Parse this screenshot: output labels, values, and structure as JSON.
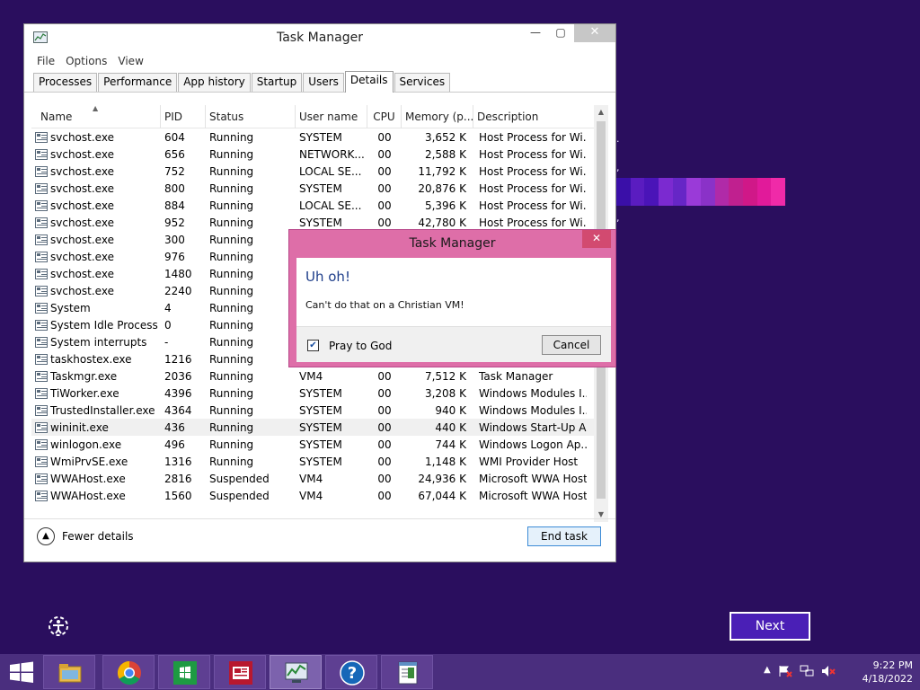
{
  "task_manager": {
    "title": "Task Manager",
    "menu": [
      "File",
      "Options",
      "View"
    ],
    "tabs": [
      "Processes",
      "Performance",
      "App history",
      "Startup",
      "Users",
      "Details",
      "Services"
    ],
    "active_tab": "Details",
    "columns": [
      "Name",
      "PID",
      "Status",
      "User name",
      "CPU",
      "Memory (p...",
      "Description"
    ],
    "rows": [
      {
        "name": "svchost.exe",
        "pid": "604",
        "status": "Running",
        "user": "SYSTEM",
        "cpu": "00",
        "mem": "3,652 K",
        "desc": "Host Process for Wi..."
      },
      {
        "name": "svchost.exe",
        "pid": "656",
        "status": "Running",
        "user": "NETWORK...",
        "cpu": "00",
        "mem": "2,588 K",
        "desc": "Host Process for Wi..."
      },
      {
        "name": "svchost.exe",
        "pid": "752",
        "status": "Running",
        "user": "LOCAL SE...",
        "cpu": "00",
        "mem": "11,792 K",
        "desc": "Host Process for Wi..."
      },
      {
        "name": "svchost.exe",
        "pid": "800",
        "status": "Running",
        "user": "SYSTEM",
        "cpu": "00",
        "mem": "20,876 K",
        "desc": "Host Process for Wi..."
      },
      {
        "name": "svchost.exe",
        "pid": "884",
        "status": "Running",
        "user": "LOCAL SE...",
        "cpu": "00",
        "mem": "5,396 K",
        "desc": "Host Process for Wi..."
      },
      {
        "name": "svchost.exe",
        "pid": "952",
        "status": "Running",
        "user": "SYSTEM",
        "cpu": "00",
        "mem": "42,780 K",
        "desc": "Host Process for Wi..."
      },
      {
        "name": "svchost.exe",
        "pid": "300",
        "status": "Running",
        "user": "",
        "cpu": "",
        "mem": "",
        "desc": ""
      },
      {
        "name": "svchost.exe",
        "pid": "976",
        "status": "Running",
        "user": "",
        "cpu": "",
        "mem": "",
        "desc": ""
      },
      {
        "name": "svchost.exe",
        "pid": "1480",
        "status": "Running",
        "user": "",
        "cpu": "",
        "mem": "",
        "desc": ""
      },
      {
        "name": "svchost.exe",
        "pid": "2240",
        "status": "Running",
        "user": "",
        "cpu": "",
        "mem": "",
        "desc": ""
      },
      {
        "name": "System",
        "pid": "4",
        "status": "Running",
        "user": "",
        "cpu": "",
        "mem": "",
        "desc": ""
      },
      {
        "name": "System Idle Process",
        "pid": "0",
        "status": "Running",
        "user": "",
        "cpu": "",
        "mem": "",
        "desc": ""
      },
      {
        "name": "System interrupts",
        "pid": "-",
        "status": "Running",
        "user": "",
        "cpu": "",
        "mem": "",
        "desc": ""
      },
      {
        "name": "taskhostex.exe",
        "pid": "1216",
        "status": "Running",
        "user": "",
        "cpu": "",
        "mem": "",
        "desc": ""
      },
      {
        "name": "Taskmgr.exe",
        "pid": "2036",
        "status": "Running",
        "user": "VM4",
        "cpu": "00",
        "mem": "7,512 K",
        "desc": "Task Manager"
      },
      {
        "name": "TiWorker.exe",
        "pid": "4396",
        "status": "Running",
        "user": "SYSTEM",
        "cpu": "00",
        "mem": "3,208 K",
        "desc": "Windows Modules I..."
      },
      {
        "name": "TrustedInstaller.exe",
        "pid": "4364",
        "status": "Running",
        "user": "SYSTEM",
        "cpu": "00",
        "mem": "940 K",
        "desc": "Windows Modules I..."
      },
      {
        "name": "wininit.exe",
        "pid": "436",
        "status": "Running",
        "user": "SYSTEM",
        "cpu": "00",
        "mem": "440 K",
        "desc": "Windows Start-Up A..."
      },
      {
        "name": "winlogon.exe",
        "pid": "496",
        "status": "Running",
        "user": "SYSTEM",
        "cpu": "00",
        "mem": "744 K",
        "desc": "Windows Logon Ap..."
      },
      {
        "name": "WmiPrvSE.exe",
        "pid": "1316",
        "status": "Running",
        "user": "SYSTEM",
        "cpu": "00",
        "mem": "1,148 K",
        "desc": "WMI Provider Host"
      },
      {
        "name": "WWAHost.exe",
        "pid": "2816",
        "status": "Suspended",
        "user": "VM4",
        "cpu": "00",
        "mem": "24,936 K",
        "desc": "Microsoft WWA Host"
      },
      {
        "name": "WWAHost.exe",
        "pid": "1560",
        "status": "Suspended",
        "user": "VM4",
        "cpu": "00",
        "mem": "67,044 K",
        "desc": "Microsoft WWA Host"
      }
    ],
    "fewer_details": "Fewer details",
    "end_task": "End task"
  },
  "dialog": {
    "title": "Task Manager",
    "heading": "Uh oh!",
    "message": "Can't do that on a Christian VM!",
    "checkbox_label": "Pray to God",
    "checkbox_checked": true,
    "cancel": "Cancel"
  },
  "desktop": {
    "next_label": "Next",
    "strip_colors": [
      "#3a0fa8",
      "#5a1cc0",
      "#4a14b8",
      "#7b2ad0",
      "#6626c6",
      "#9a3ad8",
      "#8a32c8",
      "#b02aa8",
      "#c0208f",
      "#d01888",
      "#e11a9a",
      "#f02aa8"
    ]
  },
  "taskbar": {
    "time": "9:22 PM",
    "date": "4/18/2022",
    "items": [
      "file-explorer",
      "chrome",
      "store",
      "news",
      "task-manager",
      "help",
      "notepad"
    ]
  }
}
